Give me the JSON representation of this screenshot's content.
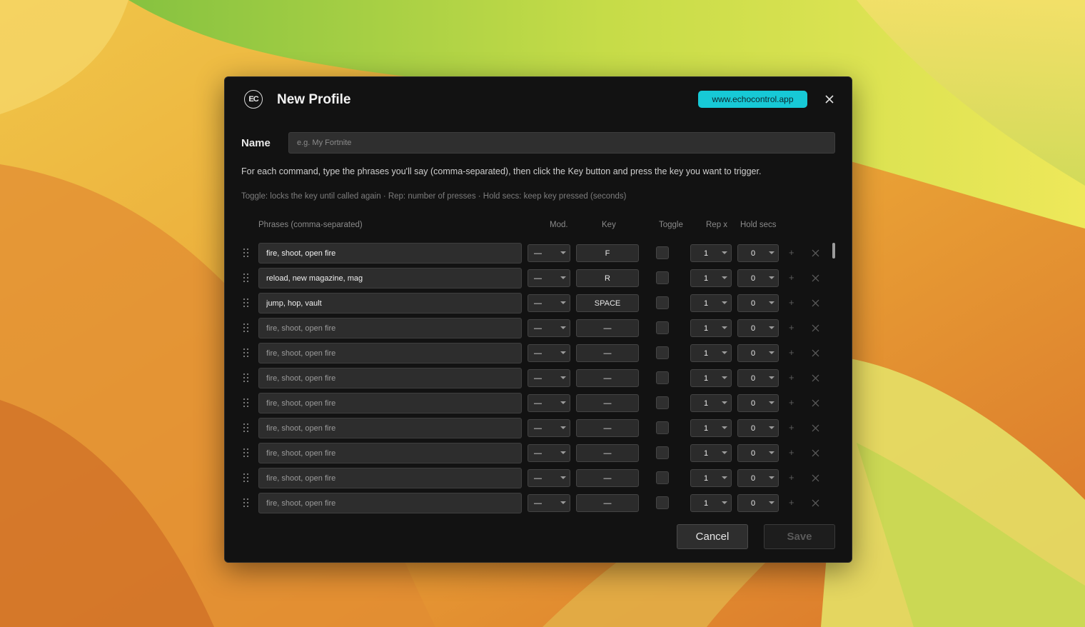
{
  "dialog": {
    "logo_text": "EC",
    "title": "New Profile",
    "site_link": "www.echocontrol.app",
    "name_label": "Name",
    "name_placeholder": "e.g. My Fortnite",
    "name_value": "",
    "instructions": "For each command, type the phrases you'll say (comma-separated), then click the Key button and press the key you want to trigger.",
    "legend": "Toggle: locks the key until called again  ·  Rep: number of presses  ·  Hold secs: keep key pressed (seconds)",
    "headers": {
      "phrases": "Phrases (comma-separated)",
      "mod": "Mod.",
      "key": "Key",
      "toggle": "Toggle",
      "rep": "Rep x",
      "hold": "Hold secs"
    },
    "rows": [
      {
        "phrases": "fire, shoot, open fire",
        "placeholder": "fire, shoot, open fire",
        "mod": "—",
        "key": "F",
        "toggle": false,
        "rep": "1",
        "hold": "0"
      },
      {
        "phrases": "reload, new magazine, mag",
        "placeholder": "fire, shoot, open fire",
        "mod": "—",
        "key": "R",
        "toggle": false,
        "rep": "1",
        "hold": "0"
      },
      {
        "phrases": "jump, hop, vault",
        "placeholder": "fire, shoot, open fire",
        "mod": "—",
        "key": "SPACE",
        "toggle": false,
        "rep": "1",
        "hold": "0"
      },
      {
        "phrases": "",
        "placeholder": "fire, shoot, open fire",
        "mod": "—",
        "key": "—",
        "toggle": false,
        "rep": "1",
        "hold": "0"
      },
      {
        "phrases": "",
        "placeholder": "fire, shoot, open fire",
        "mod": "—",
        "key": "—",
        "toggle": false,
        "rep": "1",
        "hold": "0"
      },
      {
        "phrases": "",
        "placeholder": "fire, shoot, open fire",
        "mod": "—",
        "key": "—",
        "toggle": false,
        "rep": "1",
        "hold": "0"
      },
      {
        "phrases": "",
        "placeholder": "fire, shoot, open fire",
        "mod": "—",
        "key": "—",
        "toggle": false,
        "rep": "1",
        "hold": "0"
      },
      {
        "phrases": "",
        "placeholder": "fire, shoot, open fire",
        "mod": "—",
        "key": "—",
        "toggle": false,
        "rep": "1",
        "hold": "0"
      },
      {
        "phrases": "",
        "placeholder": "fire, shoot, open fire",
        "mod": "—",
        "key": "—",
        "toggle": false,
        "rep": "1",
        "hold": "0"
      },
      {
        "phrases": "",
        "placeholder": "fire, shoot, open fire",
        "mod": "—",
        "key": "—",
        "toggle": false,
        "rep": "1",
        "hold": "0"
      },
      {
        "phrases": "",
        "placeholder": "fire, shoot, open fire",
        "mod": "—",
        "key": "—",
        "toggle": false,
        "rep": "1",
        "hold": "0"
      }
    ],
    "add_symbol": "+",
    "cancel_label": "Cancel",
    "save_label": "Save"
  },
  "colors": {
    "accent": "#17c9d6",
    "dialog_bg": "#121212",
    "input_bg": "#2d2d2d"
  },
  "icons": {
    "close": "close-icon",
    "drag": "drag-handle-icon",
    "add": "plus-icon",
    "remove": "remove-x-icon"
  }
}
